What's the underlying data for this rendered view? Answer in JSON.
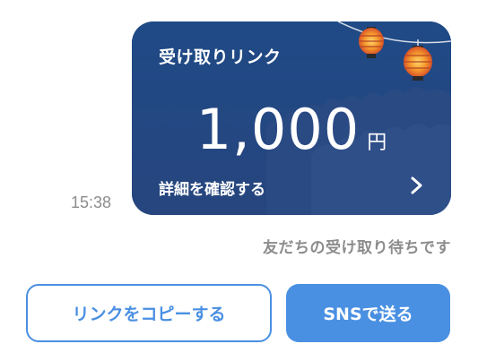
{
  "message": {
    "timestamp": "15:38",
    "status": "友だちの受け取り待ちです"
  },
  "card": {
    "title": "受け取りリンク",
    "amount": "1,000",
    "currency": "円",
    "detail_link": "詳細を確認する",
    "detail_icon": "chevron-right-icon",
    "decoration": "chochin-lanterns-and-trees",
    "colors": {
      "background": "#22487f",
      "text": "#ffffff"
    }
  },
  "actions": {
    "copy_link_label": "リンクをコピーする",
    "share_sns_label": "SNSで送る"
  },
  "colors": {
    "accent": "#4a90e2",
    "muted_text": "#8c8c8c"
  }
}
